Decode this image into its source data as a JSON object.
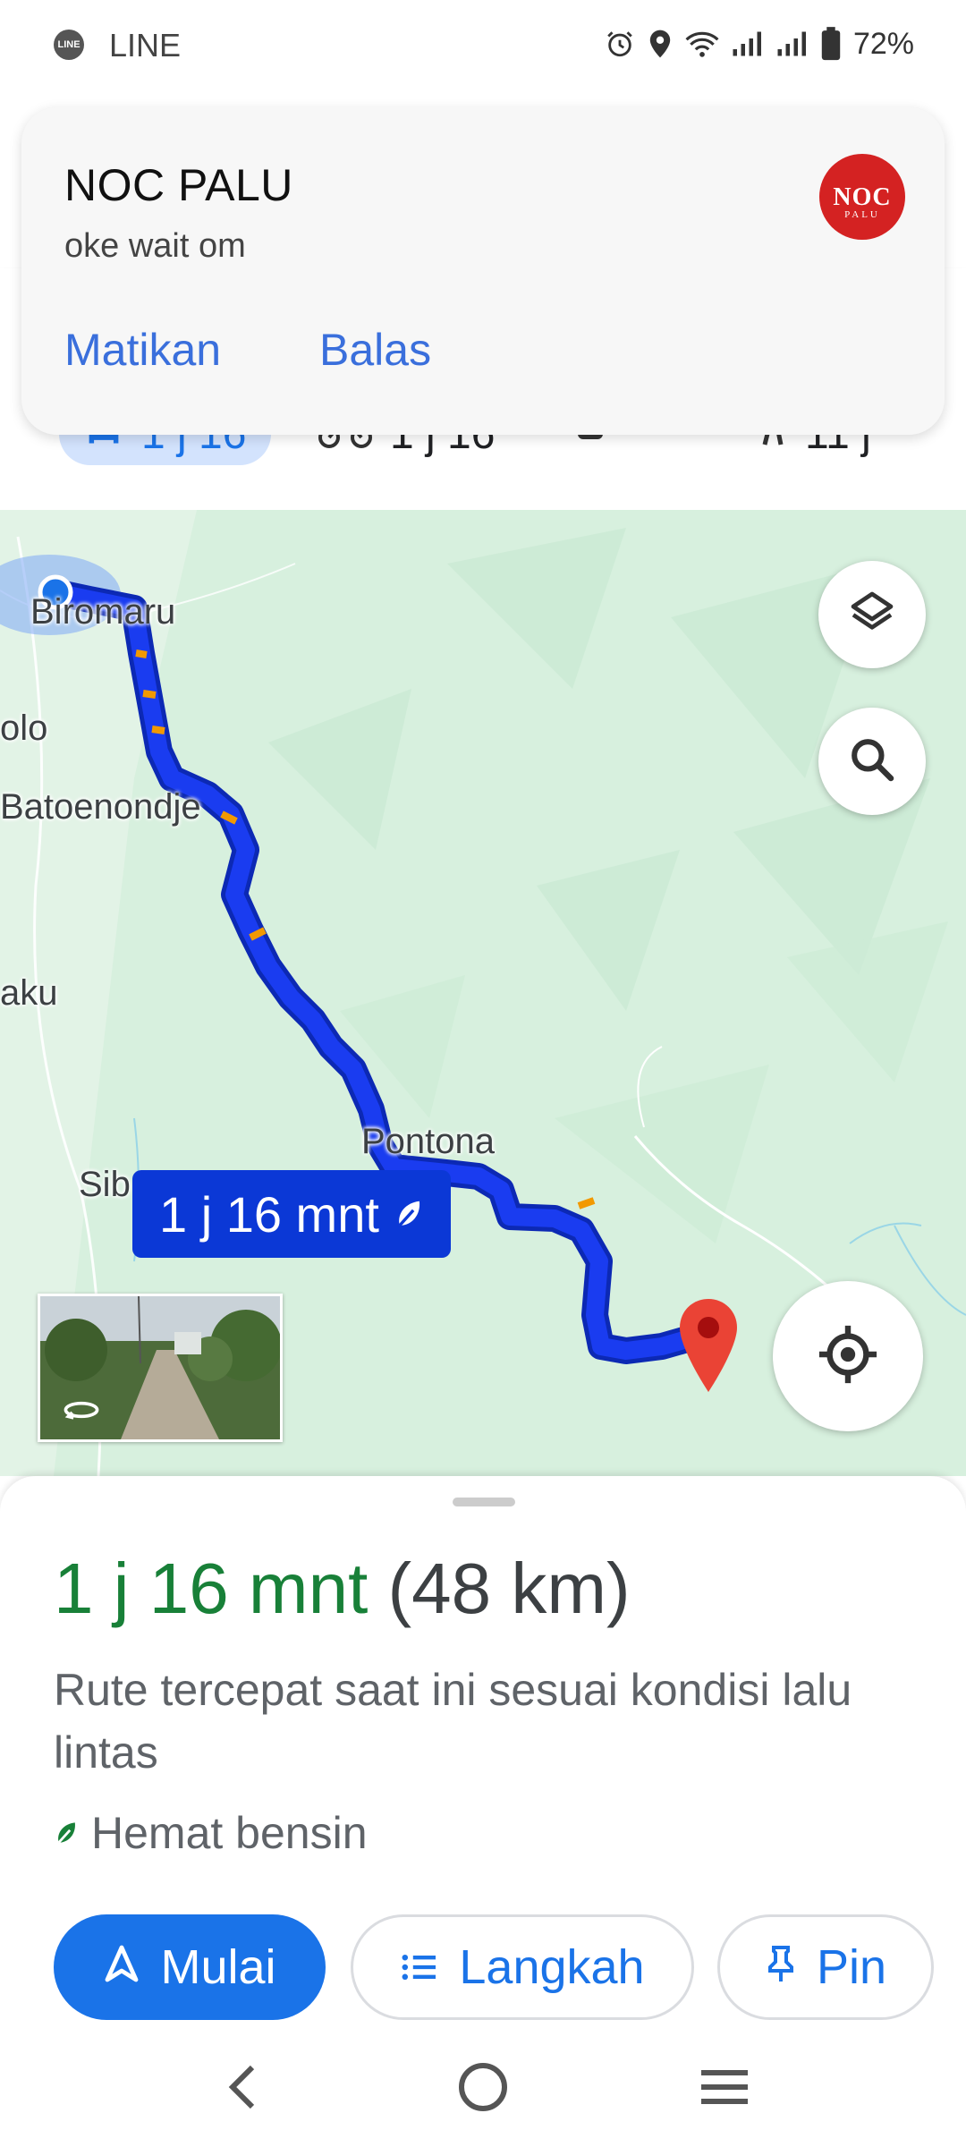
{
  "status_bar": {
    "app_name": "LINE",
    "battery": "72%",
    "icons": [
      "line-app-icon",
      "alarm-icon",
      "location-icon",
      "wifi-icon",
      "signal-icon",
      "signal-icon-2",
      "battery-icon"
    ]
  },
  "notification": {
    "title": "NOC PALU",
    "message": "oke wait om",
    "actions": {
      "mute": "Matikan",
      "reply": "Balas"
    },
    "logo_text": "NOC",
    "logo_subtext": "PALU"
  },
  "mode_tabs": {
    "car": "1 j 16",
    "motorbike": "1 j 16",
    "transit": "",
    "walk": "11 j"
  },
  "map": {
    "places": [
      "Biromaru",
      "olo",
      "Batoenondje",
      "aku",
      "Pontona",
      "Sib"
    ],
    "route_label": "1 j 16 mnt"
  },
  "route": {
    "duration": "1 j 16 mnt",
    "distance": "(48 km)",
    "description": "Rute tercepat saat ini sesuai kondisi lalu lintas",
    "eco_label": "Hemat bensin",
    "buttons": {
      "start": "Mulai",
      "steps": "Langkah",
      "pin": "Pin"
    }
  },
  "colors": {
    "accent": "#1a73e8",
    "duration_green": "#188038",
    "route_blue": "#0b38d6",
    "map_green": "#d7f0de"
  }
}
